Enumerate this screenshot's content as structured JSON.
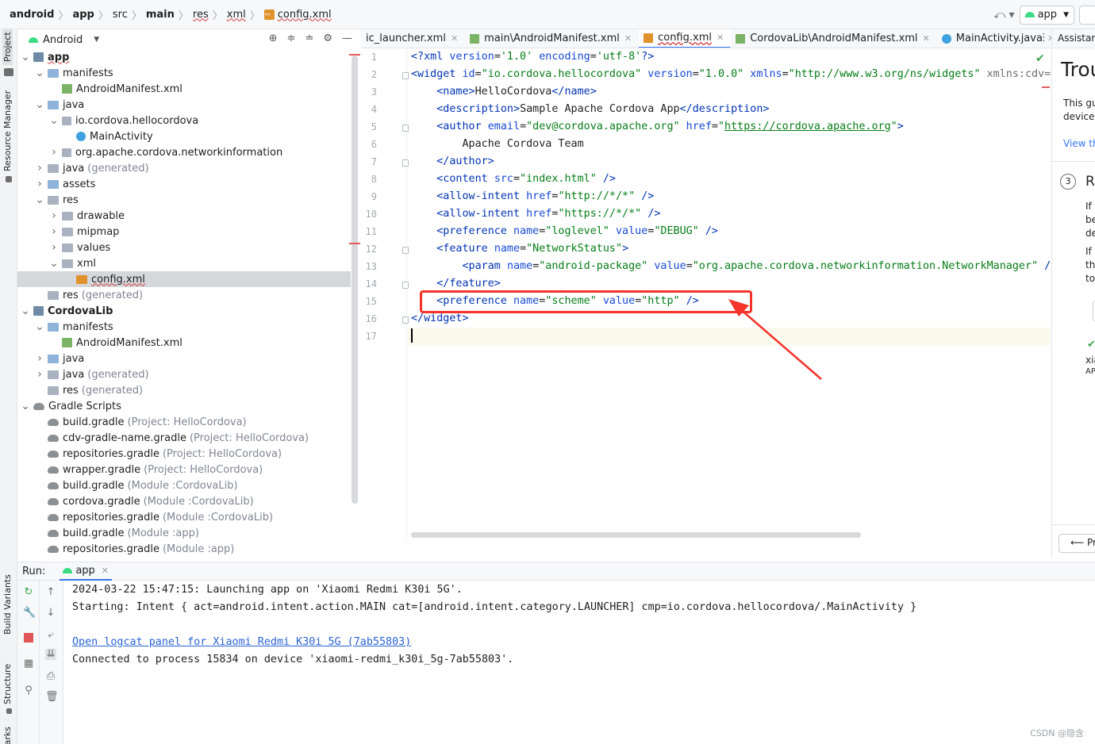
{
  "breadcrumb": [
    {
      "label": "android",
      "bold": true
    },
    {
      "label": "app",
      "bold": true
    },
    {
      "label": "src"
    },
    {
      "label": "main",
      "bold": true
    },
    {
      "label": "res",
      "wavy": true
    },
    {
      "label": "xml",
      "wavy": true
    },
    {
      "label": "config.xml",
      "wavy": true,
      "icon": "xml-file-icon"
    }
  ],
  "toolbar": {
    "run_config": "app"
  },
  "left_strip": {
    "project": "Project",
    "resource_manager": "Resource Manager",
    "build_variants": "Build Variants",
    "structure": "Structure",
    "bookmarks": "ookmarks"
  },
  "project_panel": {
    "view_mode": "Android"
  },
  "tree": [
    {
      "label": "app",
      "hint": "",
      "depth": 0,
      "arrow": "v",
      "icon": "mod",
      "bold": true,
      "wavy": true
    },
    {
      "label": "manifests",
      "hint": "",
      "depth": 1,
      "arrow": "v",
      "icon": "folder"
    },
    {
      "label": "AndroidManifest.xml",
      "hint": "",
      "depth": 2,
      "arrow": "",
      "icon": "mf"
    },
    {
      "label": "java",
      "hint": "",
      "depth": 1,
      "arrow": "v",
      "icon": "folder"
    },
    {
      "label": "io.cordova.hellocordova",
      "hint": "",
      "depth": 2,
      "arrow": "v",
      "icon": "pkg"
    },
    {
      "label": "MainActivity",
      "hint": "",
      "depth": 3,
      "arrow": "",
      "icon": "cls"
    },
    {
      "label": "org.apache.cordova.networkinformation",
      "hint": "",
      "depth": 2,
      "arrow": ">",
      "icon": "pkg"
    },
    {
      "label": "java",
      "hint": "(generated)",
      "depth": 1,
      "arrow": ">",
      "icon": "gray"
    },
    {
      "label": "assets",
      "hint": "",
      "depth": 1,
      "arrow": ">",
      "icon": "folder"
    },
    {
      "label": "res",
      "hint": "",
      "depth": 1,
      "arrow": "v",
      "icon": "gray"
    },
    {
      "label": "drawable",
      "hint": "",
      "depth": 2,
      "arrow": ">",
      "icon": "gray"
    },
    {
      "label": "mipmap",
      "hint": "",
      "depth": 2,
      "arrow": ">",
      "icon": "gray"
    },
    {
      "label": "values",
      "hint": "",
      "depth": 2,
      "arrow": ">",
      "icon": "gray"
    },
    {
      "label": "xml",
      "hint": "",
      "depth": 2,
      "arrow": "v",
      "icon": "gray"
    },
    {
      "label": "config.xml",
      "hint": "",
      "depth": 3,
      "arrow": "",
      "icon": "xml",
      "selected": true,
      "wavy": true
    },
    {
      "label": "res",
      "hint": "(generated)",
      "depth": 1,
      "arrow": "",
      "icon": "gray"
    },
    {
      "label": "CordovaLib",
      "hint": "",
      "depth": 0,
      "arrow": "v",
      "icon": "mod",
      "bold": true
    },
    {
      "label": "manifests",
      "hint": "",
      "depth": 1,
      "arrow": "v",
      "icon": "folder"
    },
    {
      "label": "AndroidManifest.xml",
      "hint": "",
      "depth": 2,
      "arrow": "",
      "icon": "mf"
    },
    {
      "label": "java",
      "hint": "",
      "depth": 1,
      "arrow": ">",
      "icon": "folder"
    },
    {
      "label": "java",
      "hint": "(generated)",
      "depth": 1,
      "arrow": ">",
      "icon": "gray"
    },
    {
      "label": "res",
      "hint": "(generated)",
      "depth": 1,
      "arrow": "",
      "icon": "gray"
    },
    {
      "label": "Gradle Scripts",
      "hint": "",
      "depth": 0,
      "arrow": "v",
      "icon": "gradle"
    },
    {
      "label": "build.gradle",
      "hint": "(Project: HelloCordova)",
      "depth": 1,
      "arrow": "",
      "icon": "gradle"
    },
    {
      "label": "cdv-gradle-name.gradle",
      "hint": "(Project: HelloCordova)",
      "depth": 1,
      "arrow": "",
      "icon": "gradle"
    },
    {
      "label": "repositories.gradle",
      "hint": "(Project: HelloCordova)",
      "depth": 1,
      "arrow": "",
      "icon": "gradle"
    },
    {
      "label": "wrapper.gradle",
      "hint": "(Project: HelloCordova)",
      "depth": 1,
      "arrow": "",
      "icon": "gradle"
    },
    {
      "label": "build.gradle",
      "hint": "(Module :CordovaLib)",
      "depth": 1,
      "arrow": "",
      "icon": "gradle"
    },
    {
      "label": "cordova.gradle",
      "hint": "(Module :CordovaLib)",
      "depth": 1,
      "arrow": "",
      "icon": "gradle"
    },
    {
      "label": "repositories.gradle",
      "hint": "(Module :CordovaLib)",
      "depth": 1,
      "arrow": "",
      "icon": "gradle"
    },
    {
      "label": "build.gradle",
      "hint": "(Module :app)",
      "depth": 1,
      "arrow": "",
      "icon": "gradle"
    },
    {
      "label": "repositories.gradle",
      "hint": "(Module :app)",
      "depth": 1,
      "arrow": "",
      "icon": "gradle"
    }
  ],
  "editor_tabs": [
    {
      "label": "ic_launcher.xml",
      "icon": "none",
      "active": false
    },
    {
      "label": "main\\AndroidManifest.xml",
      "icon": "mf",
      "active": false
    },
    {
      "label": "config.xml",
      "icon": "xml",
      "active": true
    },
    {
      "label": "CordovaLib\\AndroidManifest.xml",
      "icon": "mf",
      "active": false
    },
    {
      "label": "MainActivity.java",
      "icon": "cls",
      "active": false
    }
  ],
  "code_lines": [
    [
      [
        "pi",
        "<?"
      ],
      [
        "tg",
        "xml "
      ],
      [
        "at",
        "version"
      ],
      [
        "tx",
        "="
      ],
      [
        "av",
        "'1.0' "
      ],
      [
        "at",
        "encoding"
      ],
      [
        "tx",
        "="
      ],
      [
        "av",
        "'utf-8'"
      ],
      [
        "pi",
        "?>"
      ]
    ],
    [
      [
        "tg",
        "<widget "
      ],
      [
        "at",
        "id"
      ],
      [
        "tx",
        "="
      ],
      [
        "av",
        "\"io.cordova.hellocordova\" "
      ],
      [
        "at",
        "version"
      ],
      [
        "tx",
        "="
      ],
      [
        "av",
        "\"1.0.0\" "
      ],
      [
        "at",
        "xmlns"
      ],
      [
        "tx",
        "="
      ],
      [
        "av",
        "\"http://www.w3.org/ns/widgets\" "
      ],
      [
        "gr",
        "xmlns:cdv="
      ]
    ],
    [
      [
        "tx",
        "    "
      ],
      [
        "tg",
        "<name>"
      ],
      [
        "tx",
        "HelloCordova"
      ],
      [
        "tg",
        "</name>"
      ]
    ],
    [
      [
        "tx",
        "    "
      ],
      [
        "tg",
        "<description>"
      ],
      [
        "tx",
        "Sample Apache Cordova App"
      ],
      [
        "tg",
        "</description>"
      ]
    ],
    [
      [
        "tx",
        "    "
      ],
      [
        "tg",
        "<author "
      ],
      [
        "at",
        "email"
      ],
      [
        "tx",
        "="
      ],
      [
        "av",
        "\"dev@cordova.apache.org\" "
      ],
      [
        "at",
        "href"
      ],
      [
        "tx",
        "="
      ],
      [
        "av",
        "\""
      ],
      [
        "lk",
        "https://cordova.apache.org"
      ],
      [
        "av",
        "\""
      ],
      [
        "tg",
        ">"
      ]
    ],
    [
      [
        "tx",
        "        Apache Cordova Team"
      ]
    ],
    [
      [
        "tx",
        "    "
      ],
      [
        "tg",
        "</author>"
      ]
    ],
    [
      [
        "tx",
        "    "
      ],
      [
        "tg",
        "<content "
      ],
      [
        "at",
        "src"
      ],
      [
        "tx",
        "="
      ],
      [
        "av",
        "\"index.html\" "
      ],
      [
        "tg",
        "/>"
      ]
    ],
    [
      [
        "tx",
        "    "
      ],
      [
        "tg",
        "<allow-intent "
      ],
      [
        "at",
        "href"
      ],
      [
        "tx",
        "="
      ],
      [
        "av",
        "\"http://*/*\" "
      ],
      [
        "tg",
        "/>"
      ]
    ],
    [
      [
        "tx",
        "    "
      ],
      [
        "tg",
        "<allow-intent "
      ],
      [
        "at",
        "href"
      ],
      [
        "tx",
        "="
      ],
      [
        "av",
        "\"https://*/*\" "
      ],
      [
        "tg",
        "/>"
      ]
    ],
    [
      [
        "tx",
        "    "
      ],
      [
        "tg",
        "<preference "
      ],
      [
        "at",
        "name"
      ],
      [
        "tx",
        "="
      ],
      [
        "av",
        "\"loglevel\" "
      ],
      [
        "at",
        "value"
      ],
      [
        "tx",
        "="
      ],
      [
        "av",
        "\"DEBUG\" "
      ],
      [
        "tg",
        "/>"
      ]
    ],
    [
      [
        "tx",
        "    "
      ],
      [
        "tg",
        "<feature "
      ],
      [
        "at",
        "name"
      ],
      [
        "tx",
        "="
      ],
      [
        "av",
        "\"NetworkStatus\""
      ],
      [
        "tg",
        ">"
      ]
    ],
    [
      [
        "tx",
        "        "
      ],
      [
        "tg",
        "<param "
      ],
      [
        "at",
        "name"
      ],
      [
        "tx",
        "="
      ],
      [
        "av",
        "\"android-package\" "
      ],
      [
        "at",
        "value"
      ],
      [
        "tx",
        "="
      ],
      [
        "av",
        "\"org.apache.cordova.networkinformation.NetworkManager\" "
      ],
      [
        "tg",
        "/>"
      ]
    ],
    [
      [
        "tx",
        "    "
      ],
      [
        "tg",
        "</feature>"
      ]
    ],
    [
      [
        "tx",
        "    "
      ],
      [
        "tg",
        "<preference "
      ],
      [
        "at",
        "name"
      ],
      [
        "tx",
        "="
      ],
      [
        "av",
        "\"scheme\" "
      ],
      [
        "at",
        "value"
      ],
      [
        "tx",
        "="
      ],
      [
        "av",
        "\"http\" "
      ],
      [
        "tg",
        "/>"
      ]
    ],
    [
      [
        "tg",
        "</widget>"
      ]
    ],
    [
      [
        "tx",
        ""
      ]
    ]
  ],
  "assistant": {
    "tab": "Assistant",
    "title": "Trou",
    "lines": [
      "This gu",
      "device."
    ],
    "link": "View th",
    "step_num": "3",
    "step_title": "R",
    "step_lines": [
      "If y",
      "be",
      "de",
      "If y",
      "th",
      "to"
    ],
    "tail": [
      "xia",
      "AP"
    ],
    "button": "Pr"
  },
  "run": {
    "label": "Run:",
    "tab": "app",
    "console": [
      {
        "text": "2024-03-22 15:47:15: Launching app on 'Xiaomi Redmi K30i 5G'.",
        "link": false
      },
      {
        "text": "Starting: Intent { act=android.intent.action.MAIN cat=[android.intent.category.LAUNCHER] cmp=io.cordova.hellocordova/.MainActivity }",
        "link": false
      },
      {
        "text": "",
        "link": false
      },
      {
        "text": "Open logcat panel for Xiaomi Redmi K30i 5G (7ab55803)",
        "link": true
      },
      {
        "text": "Connected to process 15834 on device 'xiaomi-redmi_k30i_5g-7ab55803'.",
        "link": false
      }
    ]
  },
  "watermark": "CSDN @隐含",
  "colors": {
    "highlight_box": "#f4332b",
    "accent": "#3574f0"
  }
}
